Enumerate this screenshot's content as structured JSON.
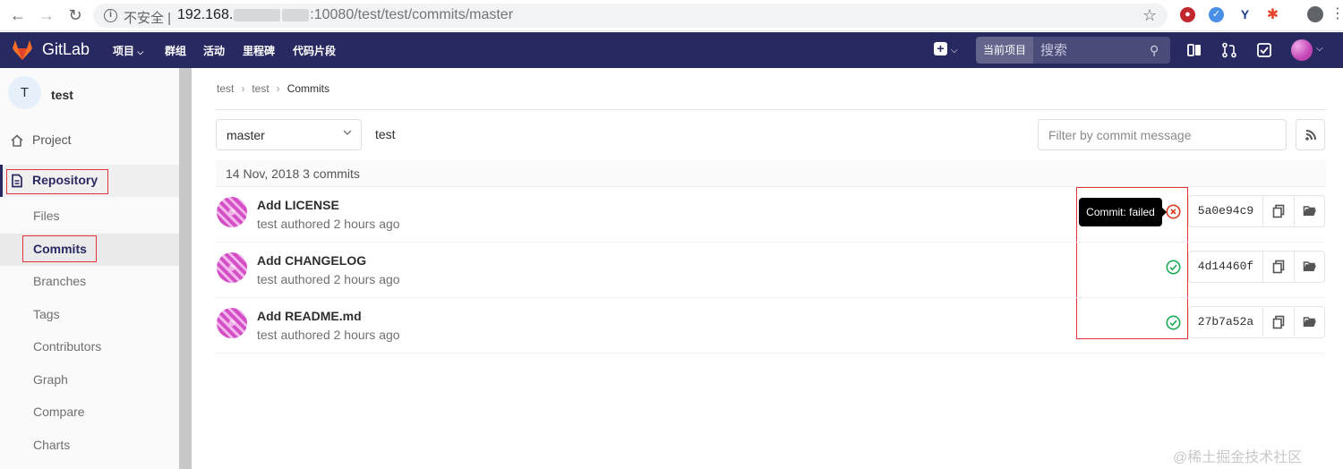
{
  "browser": {
    "insecure_label": "不安全 |",
    "url_host": "192.168.",
    "url_rest": ":10080/test/test/commits/master"
  },
  "navbar": {
    "brand": "GitLab",
    "menu": [
      "项目",
      "群组",
      "活动",
      "里程碑",
      "代码片段"
    ],
    "search_scope": "当前项目",
    "search_placeholder": "搜索",
    "colors": {
      "background": "#292961",
      "logo": "#fc6d26"
    }
  },
  "sidebar": {
    "project_initial": "T",
    "project_name": "test",
    "items": [
      {
        "label": "Project",
        "icon": "home-icon"
      },
      {
        "label": "Repository",
        "icon": "document-icon"
      }
    ],
    "sub_items": [
      "Files",
      "Commits",
      "Branches",
      "Tags",
      "Contributors",
      "Graph",
      "Compare",
      "Charts"
    ]
  },
  "breadcrumb": [
    "test",
    "test",
    "Commits"
  ],
  "toolbar": {
    "branch": "master",
    "path": "test",
    "filter_placeholder": "Filter by commit message"
  },
  "day_header": "14 Nov, 2018 3 commits",
  "commits": [
    {
      "title": "Add LICENSE",
      "meta": "test authored 2 hours ago",
      "status": "failed",
      "sha": "5a0e94c9"
    },
    {
      "title": "Add CHANGELOG",
      "meta": "test authored 2 hours ago",
      "status": "success",
      "sha": "4d14460f"
    },
    {
      "title": "Add README.md",
      "meta": "test authored 2 hours ago",
      "status": "success",
      "sha": "27b7a52a"
    }
  ],
  "tooltip": "Commit: failed",
  "status_colors": {
    "failed": "#db3b21",
    "success": "#1aaa55"
  },
  "watermark": "@稀土掘金技术社区"
}
